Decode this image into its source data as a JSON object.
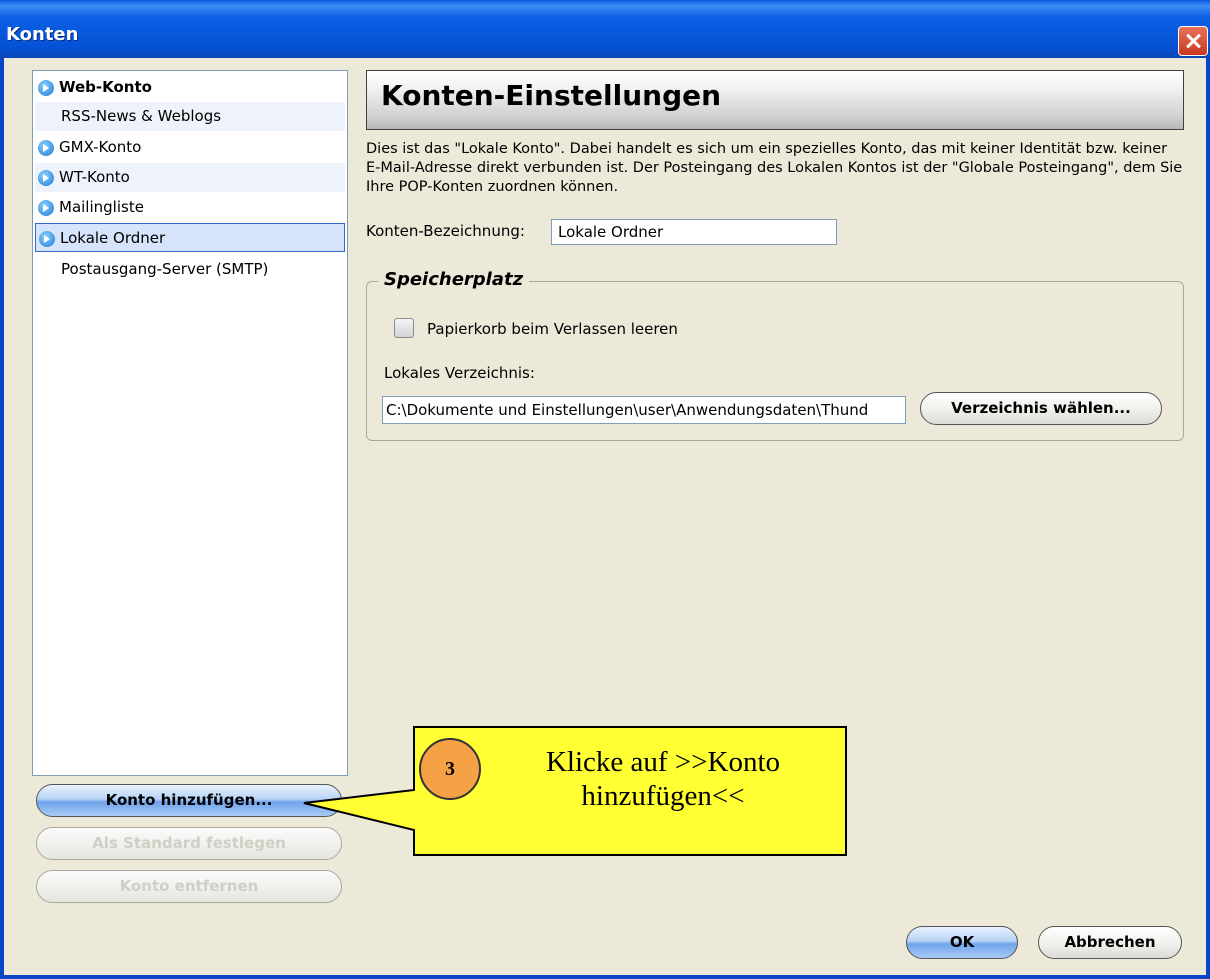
{
  "window": {
    "title": "Konten"
  },
  "sidebar": {
    "items": [
      {
        "label": "Web-Konto",
        "type": "account",
        "bold": true
      },
      {
        "label": "RSS-News & Weblogs",
        "type": "sub"
      },
      {
        "label": "GMX-Konto",
        "type": "account"
      },
      {
        "label": "WT-Konto",
        "type": "account"
      },
      {
        "label": "Mailingliste",
        "type": "account"
      },
      {
        "label": "Lokale Ordner",
        "type": "account",
        "selected": true
      },
      {
        "label": "Postausgang-Server (SMTP)",
        "type": "sub"
      }
    ],
    "buttons": {
      "add": "Konto hinzufügen...",
      "set_default": "Als Standard festlegen",
      "remove": "Konto entfernen"
    }
  },
  "main": {
    "header": "Konten-Einstellungen",
    "description": "Dies ist das \"Lokale Konto\". Dabei handelt es sich um ein spezielles Konto, das mit keiner Identität bzw. keiner E-Mail-Adresse direkt verbunden ist. Der Posteingang des Lokalen Kontos ist der \"Globale Posteingang\", dem Sie Ihre POP-Konten zuordnen können.",
    "name_label": "Konten-Bezeichnung:",
    "name_value": "Lokale Ordner",
    "storage": {
      "title": "Speicherplatz",
      "empty_trash_label": "Papierkorb beim Verlassen leeren",
      "empty_trash_checked": false,
      "local_dir_label": "Lokales Verzeichnis:",
      "local_dir_value": "C:\\Dokumente und Einstellungen\\user\\Anwendungsdaten\\Thund",
      "choose_dir_button": "Verzeichnis wählen..."
    }
  },
  "footer": {
    "ok": "OK",
    "cancel": "Abbrechen"
  },
  "callout": {
    "step": "3",
    "text": "Klicke auf >>Konto hinzufügen<<",
    "fill_color": "#ffff33",
    "badge_color": "#f5a145"
  },
  "colors": {
    "titlebar": "#0552d6",
    "window_bg": "#ece9d8",
    "selection": "#d5e3fb"
  }
}
